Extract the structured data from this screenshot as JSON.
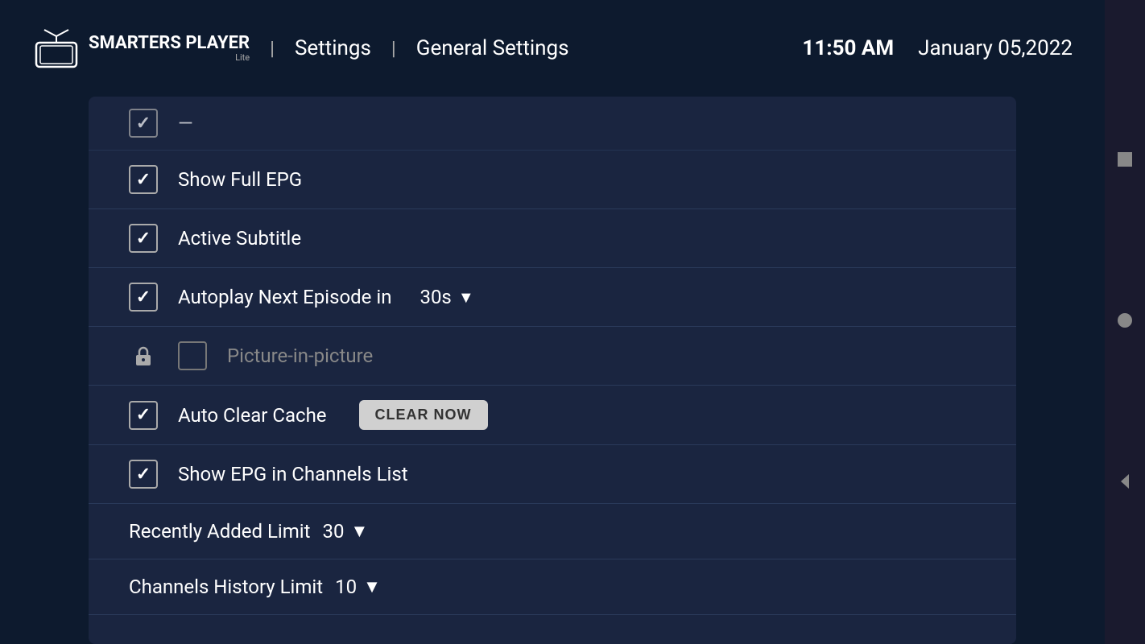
{
  "header": {
    "logo_brand": "SMARTERS PLAYER",
    "logo_lite": "Lite",
    "nav_settings": "Settings",
    "nav_general_settings": "General Settings",
    "time": "11:50 AM",
    "date": "January 05,2022"
  },
  "settings": {
    "partial_item_label": "...",
    "items": [
      {
        "id": "show-full-epg",
        "label": "Show Full EPG",
        "checked": true,
        "locked": false
      },
      {
        "id": "active-subtitle",
        "label": "Active Subtitle",
        "checked": true,
        "locked": false
      },
      {
        "id": "autoplay-next-episode",
        "label": "Autoplay Next Episode in",
        "checked": true,
        "locked": false,
        "dropdown": true,
        "dropdown_value": "30s"
      },
      {
        "id": "picture-in-picture",
        "label": "Picture-in-picture",
        "checked": false,
        "locked": true
      },
      {
        "id": "auto-clear-cache",
        "label": "Auto Clear Cache",
        "checked": true,
        "locked": false,
        "has_button": true,
        "button_label": "CLEAR NOW"
      },
      {
        "id": "show-epg-channels",
        "label": "Show EPG in Channels List",
        "checked": true,
        "locked": false
      }
    ],
    "limit_rows": [
      {
        "id": "recently-added-limit",
        "label": "Recently Added Limit",
        "value": "30"
      },
      {
        "id": "channels-history-limit",
        "label": "Channels History Limit",
        "value": "10"
      }
    ]
  },
  "right_panel": {
    "icons": [
      "square",
      "circle",
      "triangle-left"
    ]
  }
}
